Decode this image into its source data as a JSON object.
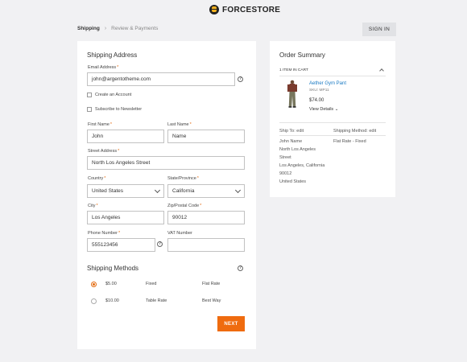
{
  "header": {
    "brand": "FORCESTORE",
    "sign_in": "SIGN IN"
  },
  "progress": {
    "step1": "Shipping",
    "separator": "›",
    "step2": "Review & Payments"
  },
  "shipping_address": {
    "title": "Shipping Address",
    "email": {
      "label": "Email Address",
      "value": "john@argentotheme.com"
    },
    "create_account": "Create an Account",
    "newsletter": "Subscribe to Newsletter",
    "first_name": {
      "label": "First Name",
      "value": "John"
    },
    "last_name": {
      "label": "Last Name",
      "value": "Name"
    },
    "street": {
      "label": "Street Address",
      "value": "North Los Angeles Street"
    },
    "country": {
      "label": "Country",
      "value": "United States"
    },
    "state": {
      "label": "State/Province",
      "value": "California"
    },
    "city": {
      "label": "City",
      "value": "Los Angeles"
    },
    "zip": {
      "label": "Zip/Postal Code",
      "value": "90012"
    },
    "phone": {
      "label": "Phone Number",
      "value": "555123456"
    },
    "vat": {
      "label": "VAT Number",
      "value": ""
    },
    "required_mark": "*"
  },
  "shipping_methods": {
    "title": "Shipping Methods",
    "options": [
      {
        "price": "$5.00",
        "method": "Fixed",
        "carrier": "Flat Rate",
        "selected": true
      },
      {
        "price": "$10.00",
        "method": "Table Rate",
        "carrier": "Best Way",
        "selected": false
      }
    ],
    "next": "NEXT"
  },
  "order_summary": {
    "title": "Order Summary",
    "items_in_cart": "1 ITEM IN CART",
    "product": {
      "name": "Aether Gym Pant",
      "sku": "SKU: MP11",
      "price": "$74.00",
      "view_details": "View Details"
    },
    "ship_to_label": "Ship To: edit",
    "shipping_method_label": "Shipping Method: edit",
    "address_lines": [
      "John Name",
      "North Los Angeles",
      "Street",
      "Los Angeles, California",
      "90012",
      "United States"
    ],
    "method_value": "Flat Rate - Fixed"
  },
  "colors": {
    "accent": "#ef6b0f",
    "link": "#1979c3",
    "background": "#f1f1f3"
  }
}
